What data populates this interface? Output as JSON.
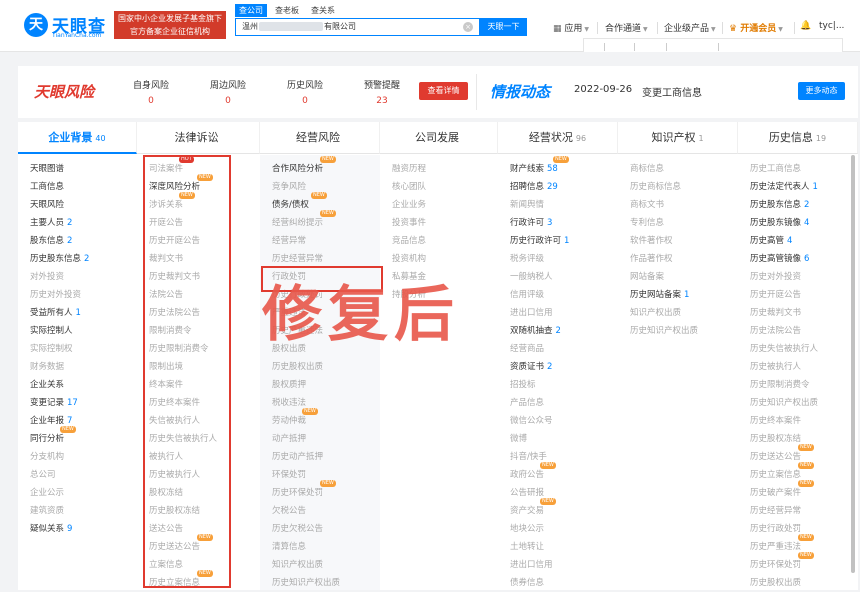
{
  "header": {
    "logo_mark": "天",
    "logo_name": "天眼查",
    "logo_domain": "TianYanCha.com",
    "promo_line1": "国家中小企业发展子基金旗下",
    "promo_line2": "官方备案企业征信机构",
    "search_tabs": [
      "查公司",
      "查老板",
      "查关系"
    ],
    "search_prefix": "温州",
    "search_suffix": "有限公司",
    "search_button": "天眼一下",
    "nav": [
      "应用",
      "合作通道",
      "企业级产品",
      "开通会员",
      "tyc|..."
    ],
    "clear_icon": "×"
  },
  "risk": {
    "title": "天眼风险",
    "items": [
      {
        "label": "自身风险",
        "value": "0"
      },
      {
        "label": "周边风险",
        "value": "0"
      },
      {
        "label": "历史风险",
        "value": "0"
      },
      {
        "label": "预警提醒",
        "value": "23"
      }
    ],
    "check_button": "查看详情",
    "intel_title": "情报动态",
    "intel_date": "2022-09-26",
    "intel_text": "变更工商信息",
    "more_button": "更多动态"
  },
  "columns": [
    {
      "title": "企业背景",
      "count": "40",
      "items": [
        {
          "label": "天眼图谱"
        },
        {
          "label": "工商信息"
        },
        {
          "label": "天眼风险"
        },
        {
          "label": "主要人员",
          "num": "2"
        },
        {
          "label": "股东信息",
          "num": "2"
        },
        {
          "label": "历史股东信息",
          "num": "2"
        },
        {
          "label": "对外投资",
          "dis": true
        },
        {
          "label": "历史对外投资",
          "dis": true
        },
        {
          "label": "受益所有人",
          "num": "1"
        },
        {
          "label": "实际控制人"
        },
        {
          "label": "实际控制权",
          "dis": true
        },
        {
          "label": "财务数据",
          "dis": true
        },
        {
          "label": "企业关系"
        },
        {
          "label": "变更记录",
          "num": "17"
        },
        {
          "label": "企业年报",
          "num": "7"
        },
        {
          "label": "同行分析",
          "badge": "NEW"
        },
        {
          "label": "分支机构",
          "dis": true
        },
        {
          "label": "总公司",
          "dis": true
        },
        {
          "label": "企业公示",
          "dis": true
        },
        {
          "label": "建筑资质",
          "dis": true
        },
        {
          "label": "疑似关系",
          "num": "9"
        }
      ]
    },
    {
      "title": "法律诉讼",
      "count": "",
      "items": [
        {
          "label": "司法案件",
          "dis": true,
          "badge": "HOT"
        },
        {
          "label": "深度风险分析",
          "badge": "NEW"
        },
        {
          "label": "涉诉关系",
          "dis": true,
          "badge": "NEW"
        },
        {
          "label": "开庭公告",
          "dis": true
        },
        {
          "label": "历史开庭公告",
          "dis": true
        },
        {
          "label": "裁判文书",
          "dis": true
        },
        {
          "label": "历史裁判文书",
          "dis": true
        },
        {
          "label": "法院公告",
          "dis": true
        },
        {
          "label": "历史法院公告",
          "dis": true
        },
        {
          "label": "限制消费令",
          "dis": true
        },
        {
          "label": "历史限制消费令",
          "dis": true
        },
        {
          "label": "限制出境",
          "dis": true
        },
        {
          "label": "终本案件",
          "dis": true
        },
        {
          "label": "历史终本案件",
          "dis": true
        },
        {
          "label": "失信被执行人",
          "dis": true
        },
        {
          "label": "历史失信被执行人",
          "dis": true
        },
        {
          "label": "被执行人",
          "dis": true
        },
        {
          "label": "历史被执行人",
          "dis": true
        },
        {
          "label": "股权冻结",
          "dis": true
        },
        {
          "label": "历史股权冻结",
          "dis": true
        },
        {
          "label": "送达公告",
          "dis": true
        },
        {
          "label": "历史送达公告",
          "dis": true,
          "badge": "NEW"
        },
        {
          "label": "立案信息",
          "dis": true
        },
        {
          "label": "历史立案信息",
          "dis": true,
          "badge": "NEW"
        }
      ]
    },
    {
      "title": "经营风险",
      "count": "",
      "items": [
        {
          "label": "合作风险分析",
          "badge": "NEW"
        },
        {
          "label": "竞争风险",
          "dis": true
        },
        {
          "label": "债务/债权",
          "badge": "NEW"
        },
        {
          "label": "经营纠纷提示",
          "dis": true,
          "badge": "NEW"
        },
        {
          "label": "经营异常",
          "dis": true
        },
        {
          "label": "历史经营异常",
          "dis": true
        },
        {
          "label": "行政处罚",
          "dis": true
        },
        {
          "label": "历史行政处罚",
          "dis": true
        },
        {
          "label": "严重违法",
          "dis": true
        },
        {
          "label": "历史严重违法",
          "dis": true
        },
        {
          "label": "股权出质",
          "dis": true
        },
        {
          "label": "历史股权出质",
          "dis": true
        },
        {
          "label": "股权质押",
          "dis": true
        },
        {
          "label": "税收违法",
          "dis": true
        },
        {
          "label": "劳动仲裁",
          "dis": true,
          "badge": "NEW"
        },
        {
          "label": "动产抵押",
          "dis": true
        },
        {
          "label": "历史动产抵押",
          "dis": true
        },
        {
          "label": "环保处罚",
          "dis": true
        },
        {
          "label": "历史环保处罚",
          "dis": true,
          "badge": "NEW"
        },
        {
          "label": "欠税公告",
          "dis": true
        },
        {
          "label": "历史欠税公告",
          "dis": true
        },
        {
          "label": "清算信息",
          "dis": true
        },
        {
          "label": "知识产权出质",
          "dis": true
        },
        {
          "label": "历史知识产权出质",
          "dis": true
        }
      ]
    },
    {
      "title": "公司发展",
      "count": "",
      "items": [
        {
          "label": "融资历程",
          "dis": true
        },
        {
          "label": "核心团队",
          "dis": true
        },
        {
          "label": "企业业务",
          "dis": true
        },
        {
          "label": "投资事件",
          "dis": true
        },
        {
          "label": "竞品信息",
          "dis": true
        },
        {
          "label": "投资机构",
          "dis": true
        },
        {
          "label": "私募基金",
          "dis": true
        },
        {
          "label": "持股分析",
          "dis": true
        }
      ]
    },
    {
      "title": "经营状况",
      "count": "96",
      "items": [
        {
          "label": "财产线索",
          "num": "58",
          "badge": "NEW"
        },
        {
          "label": "招聘信息",
          "num": "29"
        },
        {
          "label": "新闻舆情",
          "dis": true
        },
        {
          "label": "行政许可",
          "num": "3"
        },
        {
          "label": "历史行政许可",
          "num": "1"
        },
        {
          "label": "税务评级",
          "dis": true
        },
        {
          "label": "一般纳税人",
          "dis": true
        },
        {
          "label": "信用评级",
          "dis": true
        },
        {
          "label": "进出口信用",
          "dis": true
        },
        {
          "label": "双随机抽查",
          "num": "2"
        },
        {
          "label": "经营商品",
          "dis": true
        },
        {
          "label": "资质证书",
          "num": "2"
        },
        {
          "label": "招投标",
          "dis": true
        },
        {
          "label": "产品信息",
          "dis": true
        },
        {
          "label": "微信公众号",
          "dis": true
        },
        {
          "label": "微博",
          "dis": true
        },
        {
          "label": "抖音/快手",
          "dis": true
        },
        {
          "label": "政府公告",
          "dis": true,
          "badge": "NEW"
        },
        {
          "label": "公告研报",
          "dis": true
        },
        {
          "label": "资产交易",
          "dis": true,
          "badge": "NEW"
        },
        {
          "label": "地块公示",
          "dis": true
        },
        {
          "label": "土地转让",
          "dis": true
        },
        {
          "label": "进出口信用",
          "dis": true
        },
        {
          "label": "债券信息",
          "dis": true
        }
      ]
    },
    {
      "title": "知识产权",
      "count": "1",
      "items": [
        {
          "label": "商标信息",
          "dis": true
        },
        {
          "label": "历史商标信息",
          "dis": true
        },
        {
          "label": "商标文书",
          "dis": true
        },
        {
          "label": "专利信息",
          "dis": true
        },
        {
          "label": "软件著作权",
          "dis": true
        },
        {
          "label": "作品著作权",
          "dis": true
        },
        {
          "label": "网站备案",
          "dis": true
        },
        {
          "label": "历史网站备案",
          "num": "1"
        },
        {
          "label": "知识产权出质",
          "dis": true
        },
        {
          "label": "历史知识产权出质",
          "dis": true
        }
      ]
    },
    {
      "title": "历史信息",
      "count": "19",
      "items": [
        {
          "label": "历史工商信息",
          "dis": true
        },
        {
          "label": "历史法定代表人",
          "num": "1"
        },
        {
          "label": "历史股东信息",
          "num": "2"
        },
        {
          "label": "历史股东镜像",
          "num": "4"
        },
        {
          "label": "历史高管",
          "num": "4"
        },
        {
          "label": "历史高管镜像",
          "num": "6"
        },
        {
          "label": "历史对外投资",
          "dis": true
        },
        {
          "label": "历史开庭公告",
          "dis": true
        },
        {
          "label": "历史裁判文书",
          "dis": true
        },
        {
          "label": "历史法院公告",
          "dis": true
        },
        {
          "label": "历史失信被执行人",
          "dis": true
        },
        {
          "label": "历史被执行人",
          "dis": true
        },
        {
          "label": "历史限制消费令",
          "dis": true
        },
        {
          "label": "历史知识产权出质",
          "dis": true
        },
        {
          "label": "历史终本案件",
          "dis": true
        },
        {
          "label": "历史股权冻结",
          "dis": true
        },
        {
          "label": "历史送达公告",
          "dis": true,
          "badge": "NEW"
        },
        {
          "label": "历史立案信息",
          "dis": true,
          "badge": "NEW"
        },
        {
          "label": "历史破产案件",
          "dis": true,
          "badge": "NEW"
        },
        {
          "label": "历史经营异常",
          "dis": true
        },
        {
          "label": "历史行政处罚",
          "dis": true
        },
        {
          "label": "历史严重违法",
          "dis": true,
          "badge": "NEW"
        },
        {
          "label": "历史环保处罚",
          "dis": true,
          "badge": "NEW"
        },
        {
          "label": "历史股权出质",
          "dis": true
        }
      ]
    }
  ],
  "overlay_text": "修复后",
  "colors": {
    "brand": "#0084ff",
    "risk": "#e03a2f",
    "badge_new": "#f7a03a",
    "disabled": "#aaaaaa"
  }
}
